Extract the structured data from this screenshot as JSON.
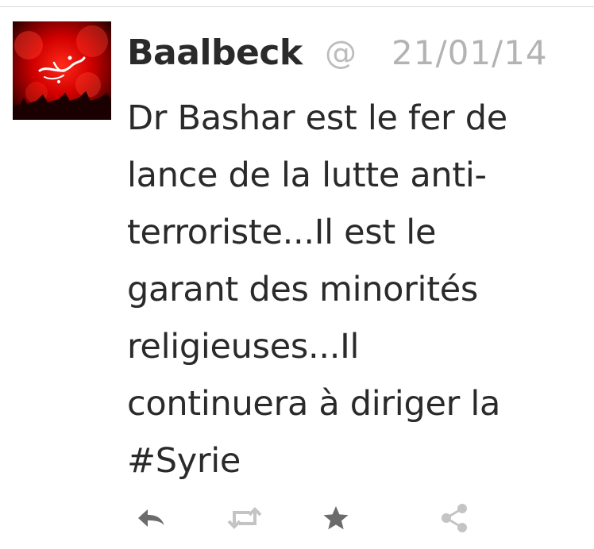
{
  "tweet": {
    "author_name": "Baalbeck",
    "handle": "@",
    "timestamp": "21/01/14",
    "body_lines": [
      "Dr Bashar est le fer de",
      "lance de la lutte anti-",
      "terroriste...Il est le",
      "garant des minorités",
      "religieuses...Il",
      "continuera à diriger la",
      "#Syrie"
    ]
  },
  "actions": [
    {
      "name": "reply",
      "icon": "reply-icon"
    },
    {
      "name": "retweet",
      "icon": "retweet-icon"
    },
    {
      "name": "favorite",
      "icon": "star-icon"
    },
    {
      "name": "share",
      "icon": "share-icon"
    }
  ],
  "colors": {
    "text": "#2a2a2a",
    "muted": "#b3b3b3",
    "icon": "#6b6b6b",
    "icon_light": "#c4c4c4",
    "avatar_red": "#d40000"
  }
}
